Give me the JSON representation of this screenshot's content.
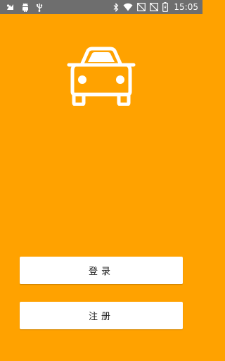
{
  "status_bar": {
    "time": "15:05",
    "left_icons": [
      "notification-icon",
      "android-debug-icon",
      "usb-icon"
    ],
    "right_icons": [
      "bluetooth-icon",
      "wifi-icon",
      "no-signal-icon",
      "no-sim-icon",
      "battery-icon"
    ],
    "background": "#6e6e6e"
  },
  "app": {
    "background": "#ffa200",
    "logo_icon": "car-icon",
    "login_label": "登录",
    "register_label": "注册"
  }
}
